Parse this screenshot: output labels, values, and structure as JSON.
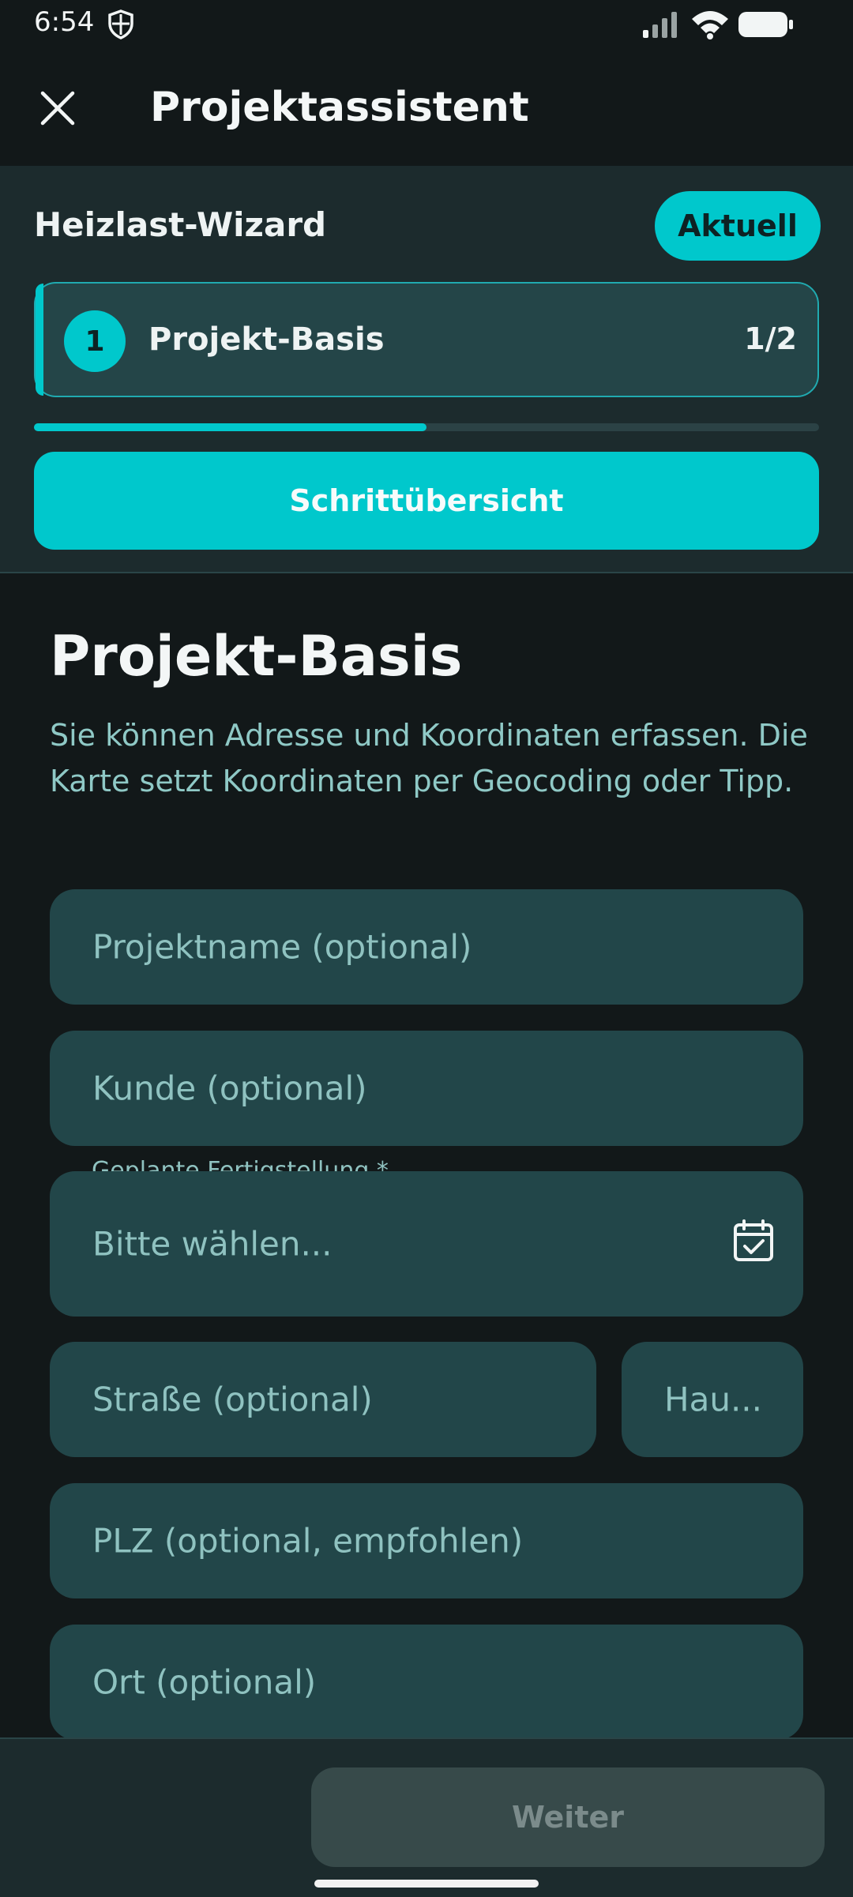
{
  "status_bar": {
    "time": "6:54"
  },
  "app_bar": {
    "title": "Projektassistent"
  },
  "wizard": {
    "title": "Heizlast-Wizard",
    "badge": "Aktuell",
    "step_number": "1",
    "step_label": "Projekt-Basis",
    "step_count": "1/2",
    "progress": 0.5,
    "overview_button": "Schrittübersicht"
  },
  "section": {
    "title": "Projekt-Basis",
    "description": "Sie können Adresse und Koordinaten erfassen. Die Karte setzt Koordinaten per Geocoding oder Tipp."
  },
  "form": {
    "project_name_placeholder": "Projektname (optional)",
    "customer_placeholder": "Kunde (optional)",
    "completion_label": "Geplante Fertigstellung *",
    "completion_placeholder": "Bitte wählen...",
    "street_placeholder": "Straße (optional)",
    "house_number_placeholder": "Hau...",
    "zip_placeholder": "PLZ (optional, empfohlen)",
    "city_placeholder": "Ort (optional)"
  },
  "footer": {
    "next_button": "Weiter"
  }
}
